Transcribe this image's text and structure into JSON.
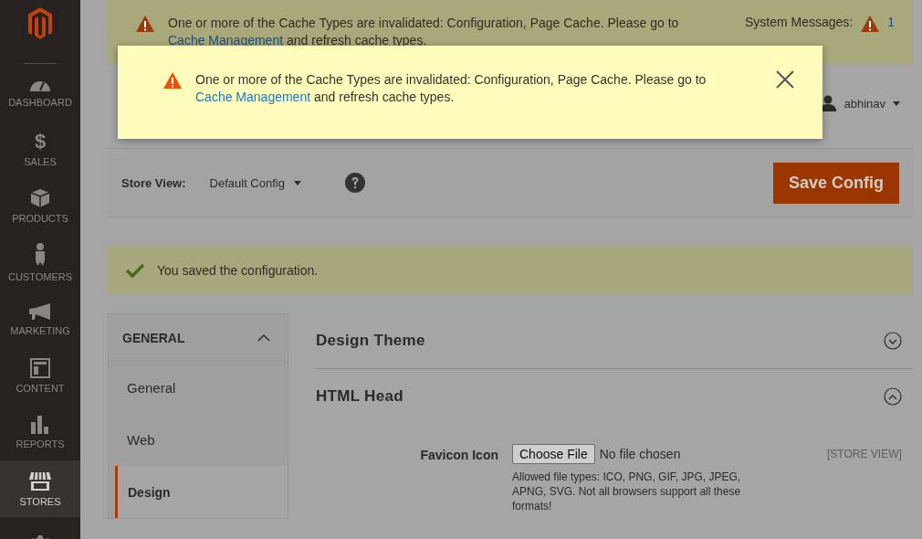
{
  "sidebar": {
    "items": [
      {
        "kind": "dashboard",
        "label": "DASHBOARD",
        "selected": false
      },
      {
        "kind": "glyph",
        "glyph": "$",
        "label": "SALES",
        "selected": false
      },
      {
        "kind": "products",
        "label": "PRODUCTS",
        "selected": false
      },
      {
        "kind": "customers",
        "label": "CUSTOMERS",
        "selected": false
      },
      {
        "kind": "marketing",
        "label": "MARKETING",
        "selected": false
      },
      {
        "kind": "content",
        "label": "CONTENT",
        "selected": false
      },
      {
        "kind": "reports",
        "label": "REPORTS",
        "selected": false
      },
      {
        "kind": "stores",
        "label": "STORES",
        "selected": true
      },
      {
        "kind": "gear",
        "selected": false
      }
    ]
  },
  "system_banner": {
    "text_before": "One or more of the Cache Types are invalidated: Configuration, Page Cache. Please go to",
    "link": "Cache Management",
    "text_after": "and refresh cache types.",
    "label": "System Messages:",
    "count": "1"
  },
  "user": {
    "name": "abhinav"
  },
  "scope": {
    "label": "Store View:",
    "value": "Default Config"
  },
  "save_button": "Save Config",
  "success_message": "You saved the configuration.",
  "config_nav": {
    "group": {
      "label": "GENERAL",
      "expanded": true
    },
    "items": [
      {
        "label": "General",
        "selected": false
      },
      {
        "label": "Web",
        "selected": false
      },
      {
        "label": "Design",
        "selected": true
      }
    ]
  },
  "sections": [
    {
      "title": "Design Theme",
      "expanded": false
    },
    {
      "title": "HTML Head",
      "expanded": true,
      "fields": [
        {
          "label": "Favicon Icon",
          "button": "Choose File",
          "status": "No file chosen",
          "note": "Allowed file types: ICO, PNG, GIF, JPG, JPEG, APNG, SVG. Not all browsers support all these formats!",
          "scope": "[STORE VIEW]"
        }
      ]
    }
  ],
  "popup": {
    "text_before": "One or more of the Cache Types are invalidated: Configuration, Page Cache. Please go to",
    "link": "Cache Management",
    "text_after": "and refresh cache types."
  }
}
